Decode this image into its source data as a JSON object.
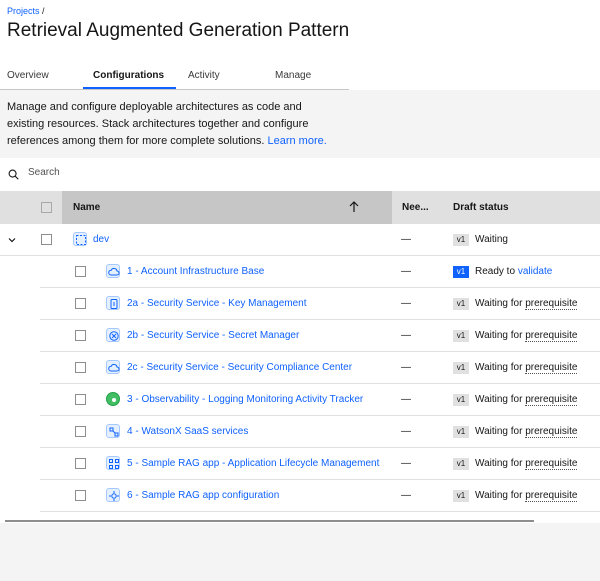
{
  "breadcrumb": {
    "projects": "Projects",
    "sep": "/"
  },
  "page_title": "Retrieval Augmented Generation Pattern",
  "tabs": [
    {
      "label": "Overview"
    },
    {
      "label": "Configurations"
    },
    {
      "label": "Activity"
    },
    {
      "label": "Manage"
    }
  ],
  "description": {
    "text": "Manage and configure deployable architectures as code and existing resources. Stack architectures together and configure references among them for more complete solutions.",
    "link": "Learn more."
  },
  "search": {
    "placeholder": "Search"
  },
  "table": {
    "headers": {
      "name": "Name",
      "needs": "Nee...",
      "draft_status": "Draft status"
    },
    "group": {
      "name": "dev",
      "needs": "—",
      "version": "v1",
      "status": "Waiting"
    },
    "rows": [
      {
        "name": "1 - Account Infrastructure Base",
        "needs": "—",
        "version": "v1",
        "status_prefix": "Ready to",
        "status_link": "validate"
      },
      {
        "name": "2a - Security Service - Key Management",
        "needs": "—",
        "version": "v1",
        "status_prefix": "Waiting for",
        "status_link": "prerequisite"
      },
      {
        "name": "2b - Security Service - Secret Manager",
        "needs": "—",
        "version": "v1",
        "status_prefix": "Waiting for",
        "status_link": "prerequisite"
      },
      {
        "name": "2c - Security Service - Security Compliance Center",
        "needs": "—",
        "version": "v1",
        "status_prefix": "Waiting for",
        "status_link": "prerequisite"
      },
      {
        "name": "3 - Observability - Logging Monitoring Activity Tracker",
        "needs": "—",
        "version": "v1",
        "status_prefix": "Waiting for",
        "status_link": "prerequisite"
      },
      {
        "name": "4 - WatsonX SaaS services",
        "needs": "—",
        "version": "v1",
        "status_prefix": "Waiting for",
        "status_link": "prerequisite"
      },
      {
        "name": "5 - Sample RAG app - Application Lifecycle Management",
        "needs": "—",
        "version": "v1",
        "status_prefix": "Waiting for",
        "status_link": "prerequisite"
      },
      {
        "name": "6 - Sample RAG app configuration",
        "needs": "—",
        "version": "v1",
        "status_prefix": "Waiting for",
        "status_link": "prerequisite"
      }
    ]
  },
  "colors": {
    "accent": "#0f62fe",
    "header_bg": "#e0e0e0",
    "page_bg": "#f4f4f4"
  }
}
